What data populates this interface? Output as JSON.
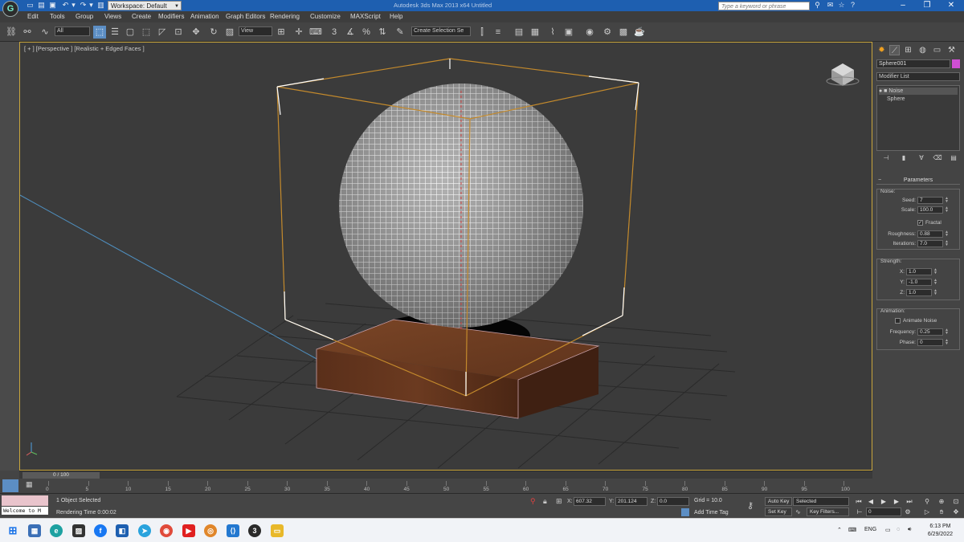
{
  "titlebar": {
    "workspace": "Workspace: Default",
    "title": "Autodesk 3ds Max  2013 x64     Untitled",
    "search_placeholder": "Type a keyword or phrase",
    "logo_letter": "G",
    "colors": {
      "bar": "#1e5fb0"
    }
  },
  "menu": [
    "Edit",
    "Tools",
    "Group",
    "Views",
    "Create",
    "Modifiers",
    "Animation",
    "Graph Editors",
    "Rendering",
    "Customize",
    "MAXScript",
    "Help"
  ],
  "toolbar": {
    "selection_filter": "All",
    "ref_coord": "View",
    "named_selection": "Create Selection Se"
  },
  "viewport": {
    "label": "[ + ] [Perspective ] [Realistic + Edged Faces ]"
  },
  "command_panel": {
    "object_name": "Sphere001",
    "object_color": "#d04fd4",
    "modifier_list": "Modifier List",
    "stack": [
      "Noise",
      "Sphere"
    ],
    "parameters_title": "Parameters",
    "noise": {
      "group": "Noise:",
      "seed_label": "Seed:",
      "seed": "7",
      "scale_label": "Scale:",
      "scale": "100.0",
      "fractal_label": "Fractal",
      "roughness_label": "Roughness:",
      "roughness": "0.88",
      "iterations_label": "Iterations:",
      "iterations": "7.0"
    },
    "strength": {
      "group": "Strength:",
      "x_label": "X:",
      "x": "1.0",
      "y_label": "Y:",
      "y": "-1.0",
      "z_label": "Z:",
      "z": "1.0"
    },
    "animation": {
      "group": "Animation:",
      "animate_noise_label": "Animate Noise",
      "frequency_label": "Frequency:",
      "frequency": "0.25",
      "phase_label": "Phase:",
      "phase": "0"
    }
  },
  "timeslider": {
    "label": "0 / 100"
  },
  "trackbar_ticks": [
    "0",
    "5",
    "10",
    "15",
    "20",
    "25",
    "30",
    "35",
    "40",
    "45",
    "50",
    "55",
    "60",
    "65",
    "70",
    "75",
    "80",
    "85",
    "90",
    "95",
    "100"
  ],
  "status": {
    "maxscript": "Welcome to M",
    "selection": "1 Object Selected",
    "render_time": "Rendering Time  0:00:02",
    "x_label": "X:",
    "x": "607.32",
    "y_label": "Y:",
    "y": "201.124",
    "z_label": "Z:",
    "z": "0.0",
    "grid": "Grid = 10.0",
    "add_time_tag": "Add Time Tag",
    "auto_key": "Auto Key",
    "selected": "Selected",
    "set_key": "Set Key",
    "key_filters": "Key Filters...",
    "frame": "0"
  },
  "taskbar": {
    "lang": "ENG",
    "time": "6:13 PM",
    "date": "6/29/2022"
  }
}
